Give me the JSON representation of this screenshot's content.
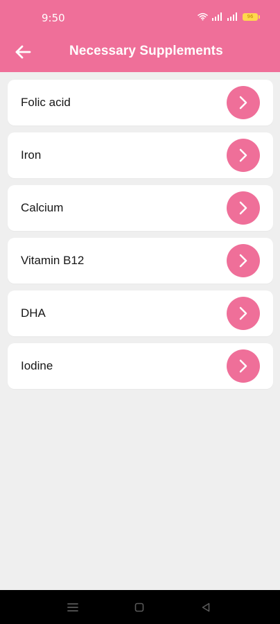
{
  "status_bar": {
    "time": "9:50",
    "battery_text": "96"
  },
  "app_bar": {
    "title": "Necessary Supplements",
    "back_icon": "arrow-left-icon"
  },
  "supplements": [
    {
      "label": "Folic acid"
    },
    {
      "label": "Iron"
    },
    {
      "label": "Calcium"
    },
    {
      "label": "Vitamin B12"
    },
    {
      "label": "DHA"
    },
    {
      "label": "Iodine"
    }
  ],
  "colors": {
    "accent": "#ef6f99",
    "background": "#efefef",
    "card": "#ffffff",
    "nav_bar": "#000000"
  },
  "nav_bar": {
    "items": [
      "menu-icon",
      "home-icon",
      "back-triangle-icon"
    ]
  }
}
